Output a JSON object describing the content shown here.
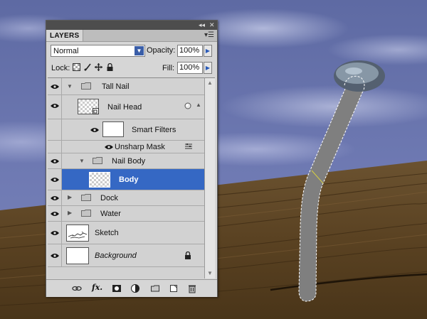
{
  "panel": {
    "tab_label": "LAYERS",
    "blend_mode": "Normal",
    "opacity_label": "Opacity:",
    "opacity_value": "100%",
    "lock_label": "Lock:",
    "fill_label": "Fill:",
    "fill_value": "100%"
  },
  "layers": [
    {
      "name": "Tall Nail",
      "type": "group",
      "visible": true,
      "expanded": true
    },
    {
      "name": "Nail Head",
      "type": "smart-object",
      "visible": true
    },
    {
      "name": "Smart Filters",
      "type": "smart-filters",
      "visible": true
    },
    {
      "name": "Unsharp Mask",
      "type": "filter",
      "visible": true
    },
    {
      "name": "Nail Body",
      "type": "group",
      "visible": true,
      "expanded": true
    },
    {
      "name": "Body",
      "type": "layer",
      "visible": true,
      "selected": true
    },
    {
      "name": "Dock",
      "type": "group",
      "visible": true,
      "expanded": false
    },
    {
      "name": "Water",
      "type": "group",
      "visible": true,
      "expanded": false
    },
    {
      "name": "Sketch",
      "type": "layer",
      "visible": true
    },
    {
      "name": "Background",
      "type": "background",
      "visible": true,
      "locked": true,
      "italic": true
    }
  ],
  "colors": {
    "selection": "#3568c4",
    "panel_bg": "#d6d6d6",
    "sky": "#6f7ab3",
    "wood": "#5c4423"
  },
  "icons": {
    "lock_row": [
      "lock-transparent-pixels-icon",
      "lock-image-pixels-icon",
      "lock-position-icon",
      "lock-all-icon"
    ],
    "bottom_bar": [
      "link-layers-icon",
      "layer-style-fx-icon",
      "add-mask-icon",
      "adjustment-layer-icon",
      "new-group-icon",
      "new-layer-icon",
      "delete-layer-icon"
    ]
  }
}
